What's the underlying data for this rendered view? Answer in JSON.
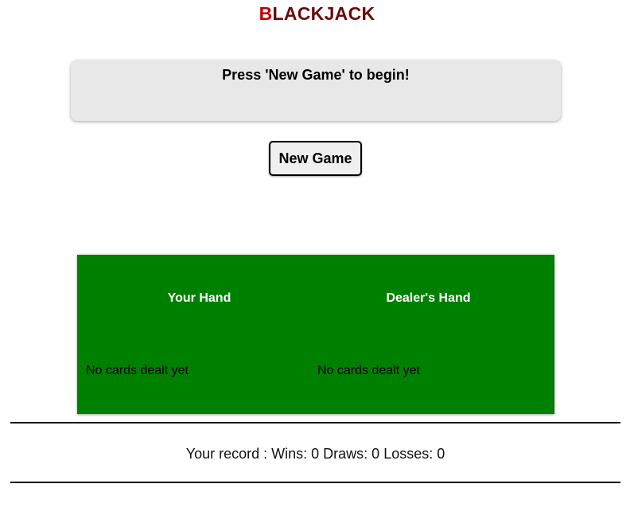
{
  "app": {
    "title_first_letter": "B",
    "title_rest": "LACKJACK"
  },
  "message": {
    "text": "Press 'New Game' to begin!"
  },
  "controls": {
    "new_game_label": "New Game"
  },
  "table": {
    "player": {
      "title": "Your Hand",
      "cards_text": "No cards dealt yet"
    },
    "dealer": {
      "title": "Dealer's Hand",
      "cards_text": "No cards dealt yet"
    }
  },
  "record": {
    "text": "Your record : Wins: 0 Draws: 0 Losses: 0"
  },
  "colors": {
    "title_accent": "#c00000",
    "title_main": "#6b0a0a",
    "table_felt": "#008000",
    "message_bg": "#e8e8e8"
  }
}
